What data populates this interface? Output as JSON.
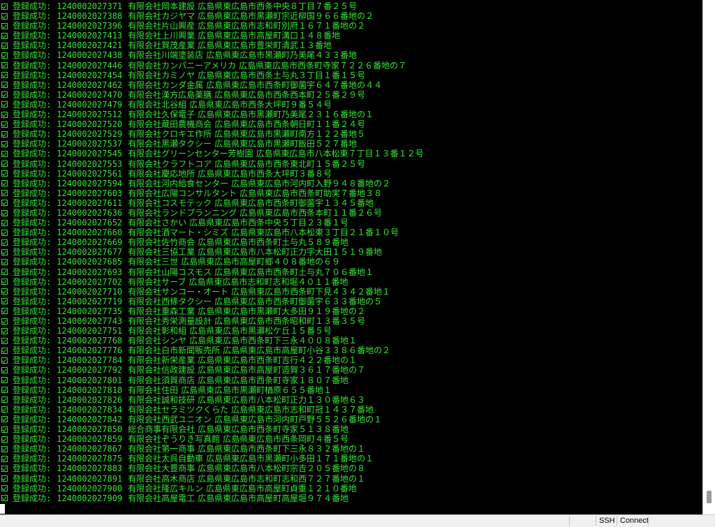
{
  "terminal": {
    "text_color": "#32e632",
    "background": "#000000",
    "lines": [
      {
        "status": "登録成功:",
        "id": "1240002027371",
        "company": "有限会社岡本建設",
        "address": "広島県東広島市西条中央８丁目７番２５号"
      },
      {
        "status": "登録成功:",
        "id": "1240002027388",
        "company": "有限会社カジヤマ",
        "address": "広島県東広島市黒瀬町宗近柳国９６６番地の２"
      },
      {
        "status": "登録成功:",
        "id": "1240002027396",
        "company": "有限会社片山興産",
        "address": "広島県東広島市志和町別府１６７１番地の２"
      },
      {
        "status": "登録成功:",
        "id": "1240002027413",
        "company": "有限会社上川興業",
        "address": "広島県東広島市高屋町溝口１４８番地"
      },
      {
        "status": "登録成功:",
        "id": "1240002027421",
        "company": "有限会社賀茂産業",
        "address": "広島県東広島市豊栄町清武１３番地"
      },
      {
        "status": "登録成功:",
        "id": "1240002027438",
        "company": "有限会社川端塗装店",
        "address": "広島県東広島市黒瀬町乃美尾４３３番地"
      },
      {
        "status": "登録成功:",
        "id": "1240002027446",
        "company": "有限会社カンパニーアメリカ",
        "address": "広島県東広島市西条町寺家７２２６番地の７"
      },
      {
        "status": "登録成功:",
        "id": "1240002027454",
        "company": "有限会社カミノヤ",
        "address": "広島県東広島市西条土与丸３丁目１番１５号"
      },
      {
        "status": "登録成功:",
        "id": "1240002027462",
        "company": "有限会社カンダ金属",
        "address": "広島県東広島市西条町御薗宇６４７番地の４４"
      },
      {
        "status": "登録成功:",
        "id": "1240002027470",
        "company": "有限会社漢方広島薬膳",
        "address": "広島県東広島市西条西本町２５番２９号"
      },
      {
        "status": "登録成功:",
        "id": "1240002027479",
        "company": "有限会社北谷組",
        "address": "広島県東広島市西条大坪町９番５４号"
      },
      {
        "status": "登録成功:",
        "id": "1240002027512",
        "company": "有限会社久保電子",
        "address": "広島県東広島市黒瀬町乃美尾２３１６番地の１"
      },
      {
        "status": "登録成功:",
        "id": "1240002027520",
        "company": "有限会社蔵田農機商会",
        "address": "広島県東広島市西条朝日町１１番２４号"
      },
      {
        "status": "登録成功:",
        "id": "1240002027529",
        "company": "有限会社クロキエ作所",
        "address": "広島県東広島市黒瀬町南方１２２番地５"
      },
      {
        "status": "登録成功:",
        "id": "1240002027537",
        "company": "有限会社黒瀬タクシー",
        "address": "広島県東広島市黒瀬町飯田５２７番地"
      },
      {
        "status": "登録成功:",
        "id": "1240002027545",
        "company": "有限会社グリーンセンター芳樹園",
        "address": "広島県東広島市八本松東７丁目１３番１２号"
      },
      {
        "status": "登録成功:",
        "id": "1240002027553",
        "company": "有限会社クラフトコア",
        "address": "広島県東広島市西条東北町１５番２５号"
      },
      {
        "status": "登録成功:",
        "id": "1240002027561",
        "company": "有限会社慶応地所",
        "address": "広島県東広島市西条大坪町３番８号"
      },
      {
        "status": "登録成功:",
        "id": "1240002027594",
        "company": "有限会社河内給食センター",
        "address": "広島県東広島市河内町入野９４８番地の２"
      },
      {
        "status": "登録成功:",
        "id": "1240002027603",
        "company": "有限会社広陽コンサルタント",
        "address": "広島県東広島市西条町助実７番地３８"
      },
      {
        "status": "登録成功:",
        "id": "1240002027611",
        "company": "有限会社コスモテック",
        "address": "広島県東広島市西条町御薗宇１３４５番地"
      },
      {
        "status": "登録成功:",
        "id": "1240002027636",
        "company": "有限会社ランドプランニング",
        "address": "広島県東広島市西条本町１１番２６号"
      },
      {
        "status": "登録成功:",
        "id": "1240002027652",
        "company": "有限会社さかい",
        "address": "広島県東広島市西条中央５丁目２３番１号"
      },
      {
        "status": "登録成功:",
        "id": "1240002027660",
        "company": "有限会社酒マート・シミズ",
        "address": "広島県東広島市八本松東３丁目２１番１０号"
      },
      {
        "status": "登録成功:",
        "id": "1240002027669",
        "company": "有限会社佐竹商会",
        "address": "広島県東広島市西条町土与丸５８９番地"
      },
      {
        "status": "登録成功:",
        "id": "1240002027677",
        "company": "有限会社三協工業",
        "address": "広島県東広島市八本松町正力字大田１５１９番地"
      },
      {
        "status": "登録成功:",
        "id": "1240002027685",
        "company": "有限会社三世",
        "address": "広島県東広島市高屋町郷４０８番地の６９"
      },
      {
        "status": "登録成功:",
        "id": "1240002027693",
        "company": "有限会社山陽コスモス",
        "address": "広島県東広島市西条町土与丸７０６番地１"
      },
      {
        "status": "登録成功:",
        "id": "1240002027702",
        "company": "有限会社サーブ",
        "address": "広島県東広島市志和町志和堀４０１１番地"
      },
      {
        "status": "登録成功:",
        "id": "1240002027710",
        "company": "有限会社サンコー・オート",
        "address": "広島県東広島市西条町下見４３４２番地１"
      },
      {
        "status": "登録成功:",
        "id": "1240002027719",
        "company": "有限会社西條タクシー",
        "address": "広島県東広島市西条町御薗宇６３３番地の５"
      },
      {
        "status": "登録成功:",
        "id": "1240002027735",
        "company": "有限会社重森工業",
        "address": "広島県東広島市黒瀬町大多田９１９番地の２"
      },
      {
        "status": "登録成功:",
        "id": "1240002027743",
        "company": "有限会社秀栄測量設計",
        "address": "広島県東広島市西条昭和町１３番３５号"
      },
      {
        "status": "登録成功:",
        "id": "1240002027751",
        "company": "有限会社彰和組",
        "address": "広島県東広島市黒瀬松ケ丘１５番５号"
      },
      {
        "status": "登録成功:",
        "id": "1240002027768",
        "company": "有限会社シンヤ",
        "address": "広島県東広島市西条町下三永４００８番地１"
      },
      {
        "status": "登録成功:",
        "id": "1240002027776",
        "company": "有限会社白市新聞販売所",
        "address": "広島県東広島市高屋町小谷３３８６番地の２"
      },
      {
        "status": "登録成功:",
        "id": "1240002027784",
        "company": "有限会社新栄産業",
        "address": "広島県東広島市西条町吉行４２２番地の１"
      },
      {
        "status": "登録成功:",
        "id": "1240002027792",
        "company": "有限会社信政建設",
        "address": "広島県東広島市高屋町造賀３６１７番地の７"
      },
      {
        "status": "登録成功:",
        "id": "1240002027801",
        "company": "有限会社須賀商店",
        "address": "広島県東広島市西条町寺家１８０７番地"
      },
      {
        "status": "登録成功:",
        "id": "1240002027818",
        "company": "有限会社住田",
        "address": "広島県東広島市黒瀬町楢原６５５番地１"
      },
      {
        "status": "登録成功:",
        "id": "1240002027826",
        "company": "有限会社誠和技研",
        "address": "広島県東広島市八本松町正力１３０番地６３"
      },
      {
        "status": "登録成功:",
        "id": "1240002027834",
        "company": "有限会社セラミツクくらた",
        "address": "広島県東広島市志和町冠１４３７番地"
      },
      {
        "status": "登録成功:",
        "id": "1240002027842",
        "company": "有限会社西武ユニオン",
        "address": "広島県東広島市河内町戸野５５２６番地の１"
      },
      {
        "status": "登録成功:",
        "id": "1240002027850",
        "company": "総合商事有限会社",
        "address": "広島県東広島市西条町寺家５１３８番地"
      },
      {
        "status": "登録成功:",
        "id": "1240002027859",
        "company": "有限会社ぞうりき写真館",
        "address": "広島県東広島市西条岡町４番５号"
      },
      {
        "status": "登録成功:",
        "id": "1240002027867",
        "company": "有限会社第一商事",
        "address": "広島県東広島市西条町下三永８３２番地の１"
      },
      {
        "status": "登録成功:",
        "id": "1240002027875",
        "company": "有限会社太呉自動車",
        "address": "広島県東広島市黒瀬町小多田１７１番地の１"
      },
      {
        "status": "登録成功:",
        "id": "1240002027883",
        "company": "有限会社大豊商事",
        "address": "広島県東広島市八本松町宗吉２０５番地の８"
      },
      {
        "status": "登録成功:",
        "id": "1240002027891",
        "company": "有限会社高木商店",
        "address": "広島県東広島市志和町志和西７２７番地の１"
      },
      {
        "status": "登録成功:",
        "id": "1240002027900",
        "company": "有限会社隆広キルン",
        "address": "広島県東広島市高屋町貞重１２１０番地"
      },
      {
        "status": "登録成功:",
        "id": "1240002027909",
        "company": "有限会社高屋電工",
        "address": "広島県東広島市高屋町高屋堀９７４番地"
      }
    ]
  },
  "statusbar": {
    "ssh_label": "SSH",
    "connect_label": "Connect"
  }
}
